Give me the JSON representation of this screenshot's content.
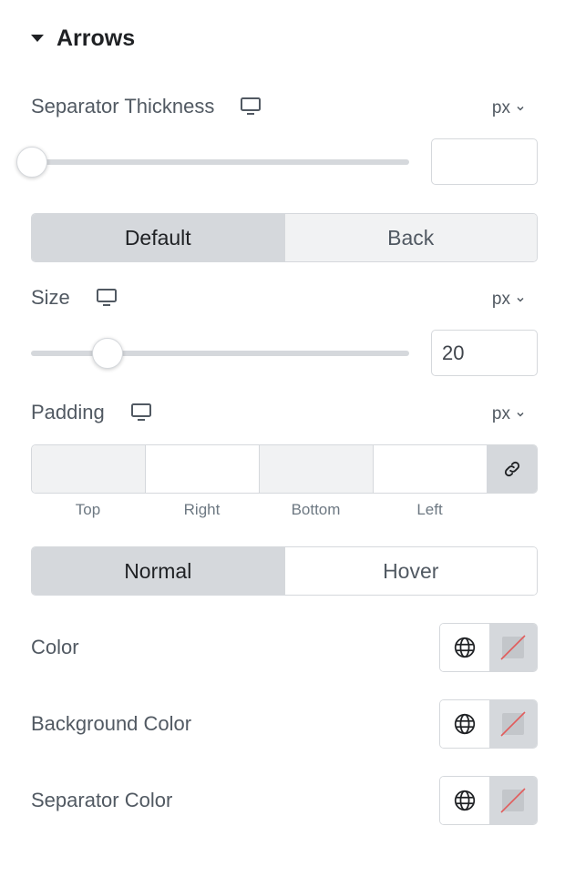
{
  "section": {
    "title": "Arrows"
  },
  "separator_thickness": {
    "label": "Separator Thickness",
    "unit": "px",
    "value": "",
    "slider_fraction": 0.0
  },
  "state_tabs": {
    "default": "Default",
    "back": "Back",
    "active": "Default"
  },
  "size": {
    "label": "Size",
    "unit": "px",
    "value": "20",
    "slider_fraction": 0.2
  },
  "padding": {
    "label": "Padding",
    "unit": "px",
    "fields": {
      "top": "Top",
      "right": "Right",
      "bottom": "Bottom",
      "left": "Left"
    }
  },
  "hover_tabs": {
    "normal": "Normal",
    "hover": "Hover",
    "active": "Normal"
  },
  "colors": {
    "color": "Color",
    "background_color": "Background Color",
    "separator_color": "Separator Color"
  },
  "icons": {
    "device": "desktop-icon",
    "unit_toggle": "chevron-down-icon",
    "link": "link-icon",
    "globe": "globe-icon",
    "swatch": "no-color-swatch-icon"
  },
  "theme": {
    "active_tab_bg": "#d5d8dc",
    "text": "#515962",
    "clear_line": "#e25c5c"
  }
}
